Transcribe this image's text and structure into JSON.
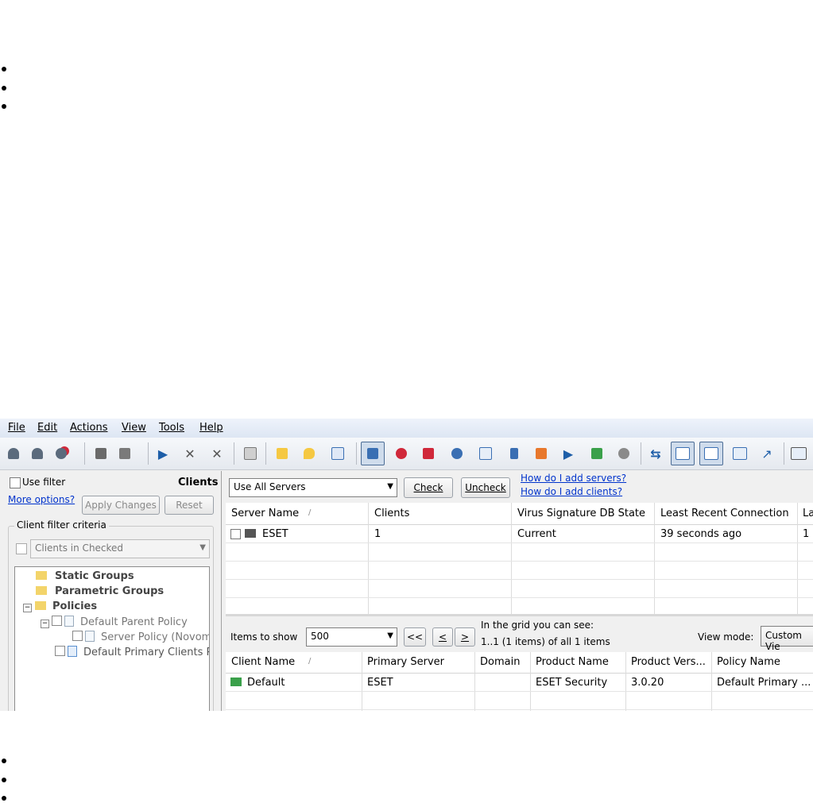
{
  "menu": [
    "File",
    "Edit",
    "Actions",
    "View",
    "Tools",
    "Help"
  ],
  "filter": {
    "use_filter_label": "Use filter",
    "clients_label": "Clients",
    "more_options": "More options?",
    "apply_changes": "Apply Changes",
    "reset": "Reset",
    "criteria_label": "Client filter criteria",
    "criteria_value": "Clients in Checked"
  },
  "tree": {
    "static_groups": "Static Groups",
    "parametric_groups": "Parametric Groups",
    "policies": "Policies",
    "default_parent_policy": "Default Parent Policy",
    "server_policy": "Server Policy (Novome",
    "default_primary": "Default Primary Clients Pol"
  },
  "servers": {
    "select_value": "Use All Servers",
    "check": "Check",
    "uncheck": "Uncheck",
    "link_servers": "How do I add servers?",
    "link_clients": "How do I add clients?",
    "headers": [
      "Server Name",
      "Clients",
      "Virus Signature DB State",
      "Least Recent Connection",
      "La"
    ],
    "rows": [
      [
        "ESET",
        "1",
        "Current",
        "39 seconds ago",
        "1"
      ]
    ]
  },
  "clients": {
    "items_label": "Items to show",
    "items_value": "500",
    "nav_first": "<<",
    "nav_prev": "<",
    "nav_next": ">",
    "grid_info_1": "In the grid you can see:",
    "grid_info_2": "1..1 (1 items) of all 1 items",
    "view_mode_label": "View mode:",
    "view_mode_value": "Custom Vie",
    "headers": [
      "Client Name",
      "Primary Server",
      "Domain",
      "Product Name",
      "Product Vers...",
      "Policy Name"
    ],
    "rows": [
      [
        "Default",
        "ESET",
        "",
        "ESET Security",
        "3.0.20",
        "Default Primary ..."
      ]
    ]
  }
}
